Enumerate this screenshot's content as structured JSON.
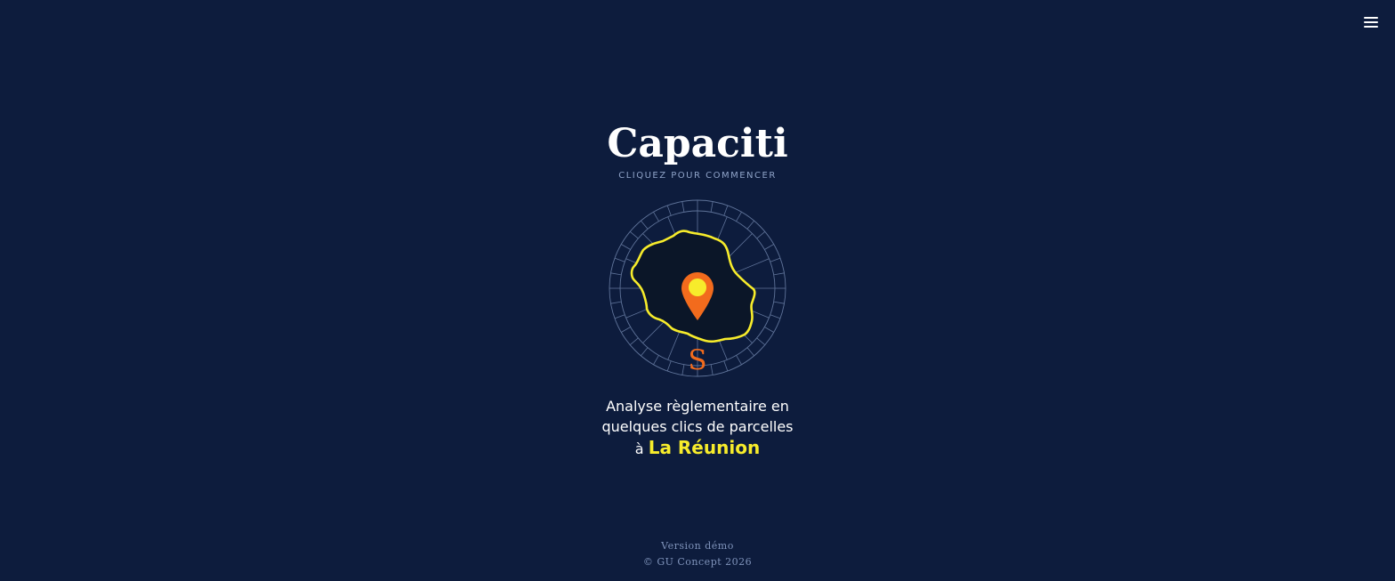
{
  "header": {
    "menu_icon": "hamburger-menu-icon"
  },
  "hero": {
    "title": "Capaciti",
    "subtitle": "CLIQUEZ POUR COMMENCER",
    "emblem_letter": "S",
    "tagline_line1": "Analyse règlementaire en",
    "tagline_line2": "quelques clics de parcelles",
    "tagline_prefix": "à",
    "tagline_highlight": "La Réunion"
  },
  "footer": {
    "version": "Version démo",
    "copyright": "© GU Concept 2026"
  },
  "colors": {
    "background": "#0d1c3d",
    "accent_yellow": "#f7ec2b",
    "accent_orange": "#f26b1d",
    "muted_text": "#8fa3c8"
  }
}
